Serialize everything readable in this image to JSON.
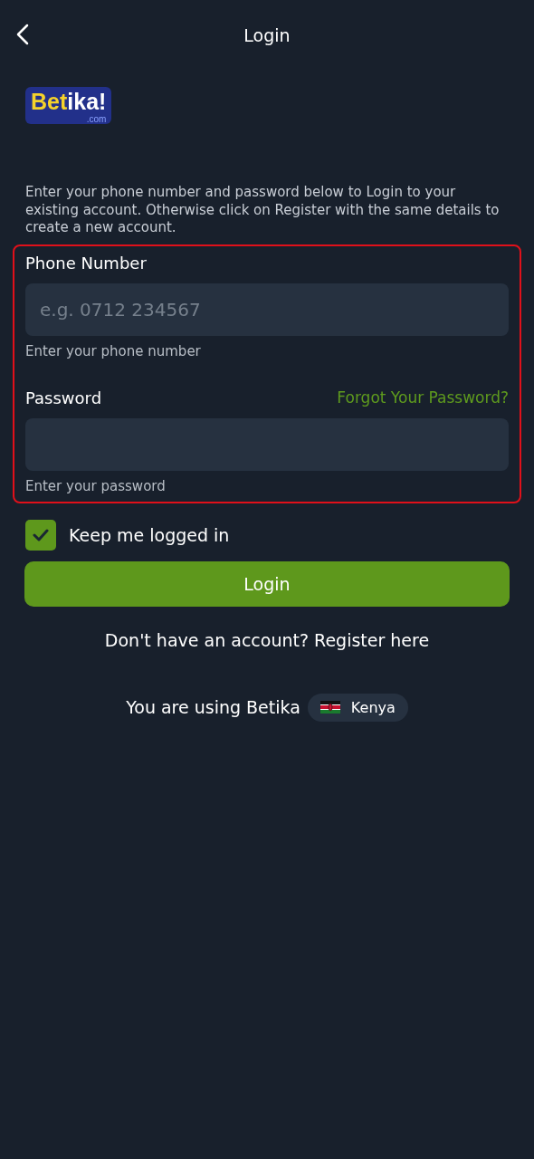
{
  "header": {
    "title": "Login"
  },
  "logo": {
    "part_1": "Bet",
    "part_2": "ika!",
    "suffix": ".com"
  },
  "intro": "Enter your phone number and password below to Login to your existing account. Otherwise click on Register with the same details to create a new account.",
  "highlighted": true,
  "phone": {
    "label": "Phone Number",
    "placeholder": "e.g. 0712 234567",
    "hint": "Enter your phone number"
  },
  "password": {
    "label": "Password",
    "forgot_link": "Forgot Your Password?",
    "hint": "Enter your password"
  },
  "keep_logged_in": {
    "label": "Keep me logged in",
    "checked": true
  },
  "login_button": "Login",
  "register_link": "Don't have an account? Register here",
  "footer": {
    "text": "You are using Betika",
    "country": "Kenya"
  }
}
